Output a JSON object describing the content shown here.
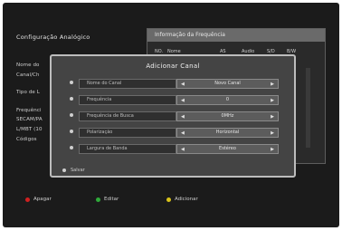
{
  "screen_title": "Configuração Analógico",
  "left_labels": [
    "Nome do",
    "Canal/Ch",
    "Tipo de L",
    "Frequênci",
    "SECAM/PA",
    "L/MBT (10",
    "Códigos"
  ],
  "freq_panel": {
    "title": "Informação da Frequência",
    "columns": [
      "NO.",
      "Nome",
      "AS",
      "Audio",
      "S/D",
      "B/W"
    ]
  },
  "dialog": {
    "title": "Adicionar Canal",
    "rows": [
      {
        "label": "Nome do Canal",
        "value": "Novo Canal"
      },
      {
        "label": "Frequência",
        "value": "0"
      },
      {
        "label": "Frequência de Busca",
        "value": "0MHz"
      },
      {
        "label": "Polarização",
        "value": "Horizontal"
      },
      {
        "label": "Largura de Banda",
        "value": "Estéreo"
      }
    ],
    "save_label": "Salvar"
  },
  "footer": [
    {
      "label": "Apagar",
      "color": "#d02020"
    },
    {
      "label": "Editar",
      "color": "#2faa3a"
    },
    {
      "label": "Adicionar",
      "color": "#d9c31a"
    }
  ],
  "colors": {
    "background": "#1b1b1b",
    "dialog": "#444444"
  }
}
